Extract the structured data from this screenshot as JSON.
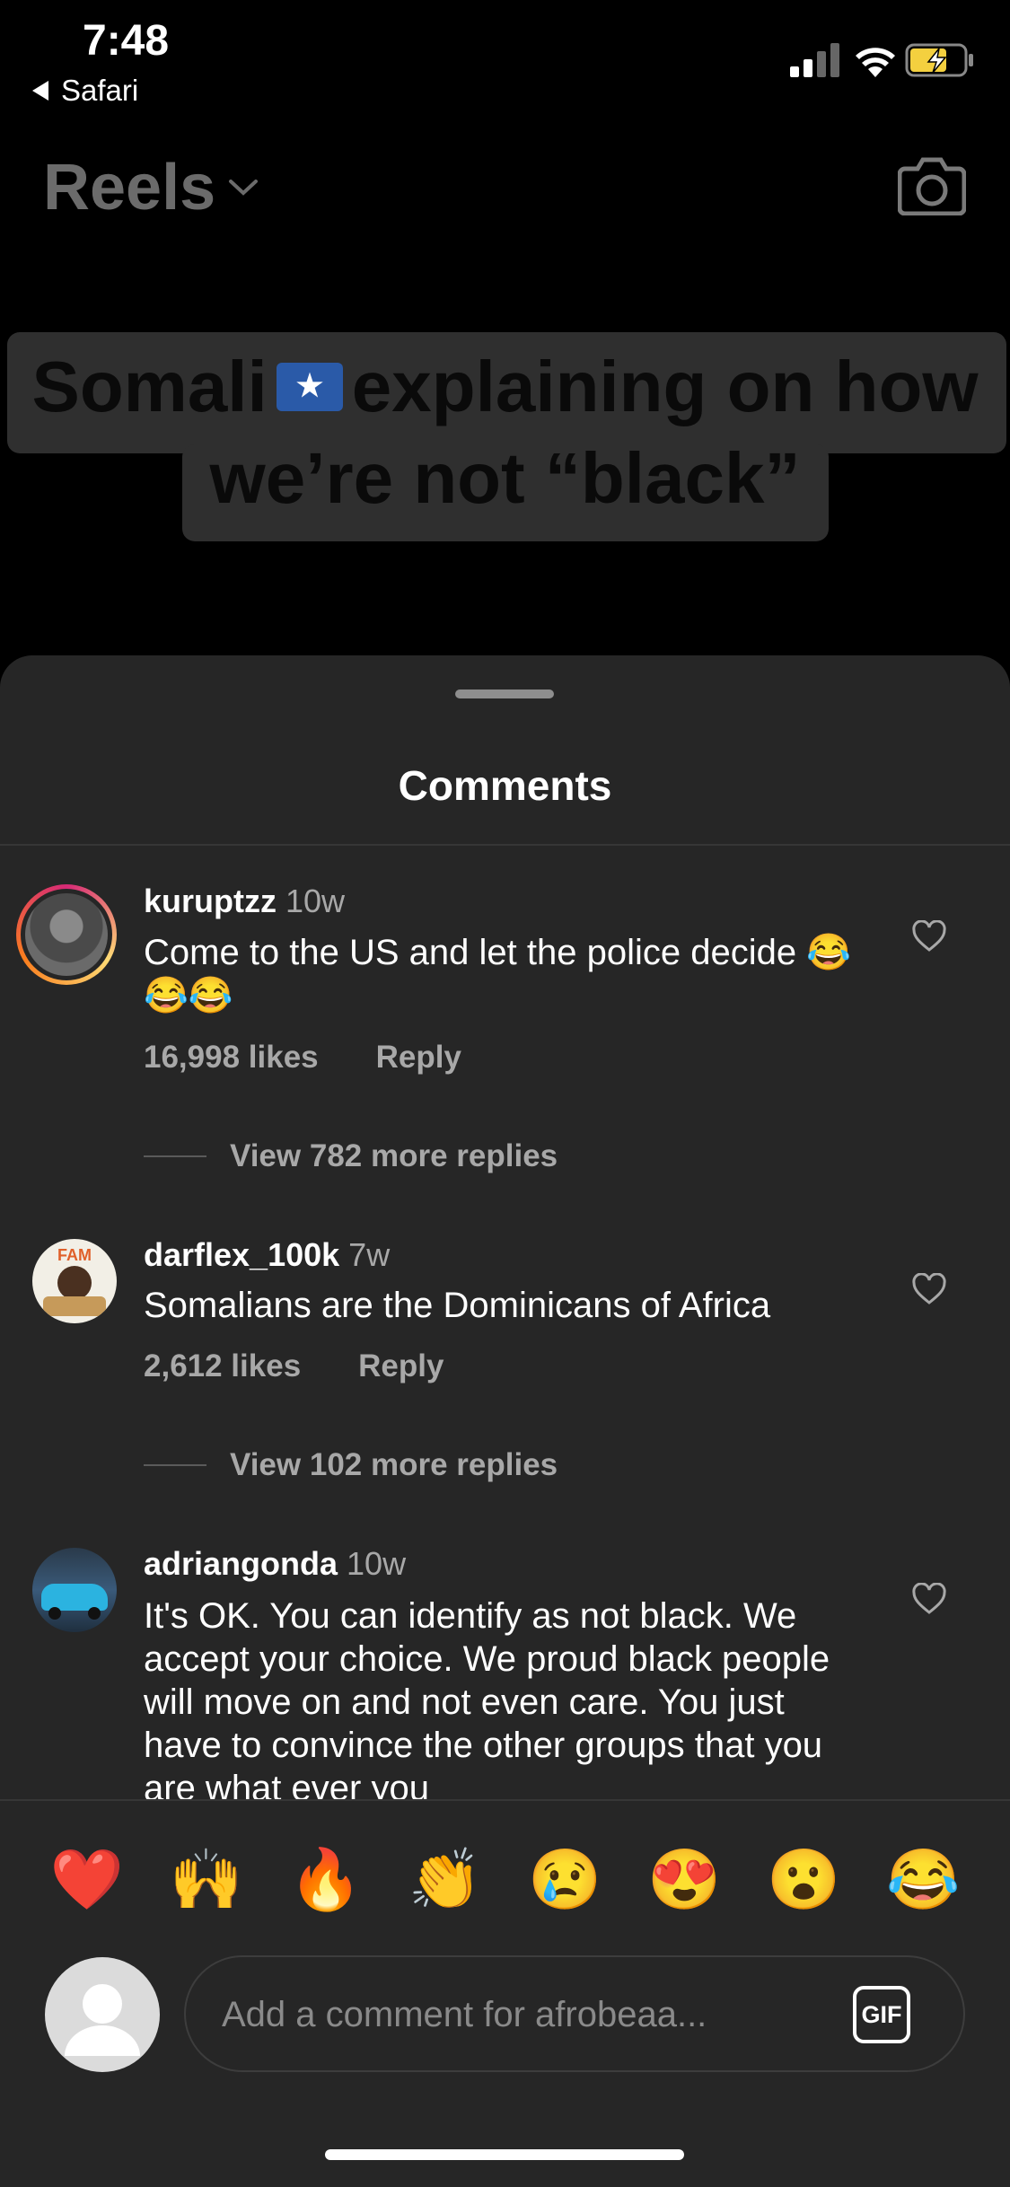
{
  "status": {
    "time": "7:48",
    "back_label": "Safari"
  },
  "header": {
    "title": "Reels"
  },
  "video": {
    "caption_line1_a": "Somali",
    "caption_line1_b": "explaining on how",
    "caption_line2": "we’re not “black”"
  },
  "sheet": {
    "title": "Comments"
  },
  "comments": [
    {
      "username": "kuruptzz",
      "age": "10w",
      "text": "Come to the US and let the police decide 😂😂😂",
      "likes": "16,998 likes",
      "reply": "Reply",
      "view_more": "View 782 more replies"
    },
    {
      "username": "darflex_100k",
      "age": "7w",
      "text": "Somalians are the Dominicans of Africa",
      "likes": "2,612 likes",
      "reply": "Reply",
      "view_more": "View 102 more replies"
    },
    {
      "username": "adriangonda",
      "age": "10w",
      "text": "It's OK.  You can identify as not black. We accept your choice.  We proud black people will move on and not even care. You just have to convince the other groups that you are what ever you"
    }
  ],
  "reactions": [
    "❤️",
    "🙌",
    "🔥",
    "👏",
    "😢",
    "😍",
    "😮",
    "😂"
  ],
  "composer": {
    "placeholder": "Add a comment for afrobeaa...",
    "gif_label": "GIF"
  }
}
